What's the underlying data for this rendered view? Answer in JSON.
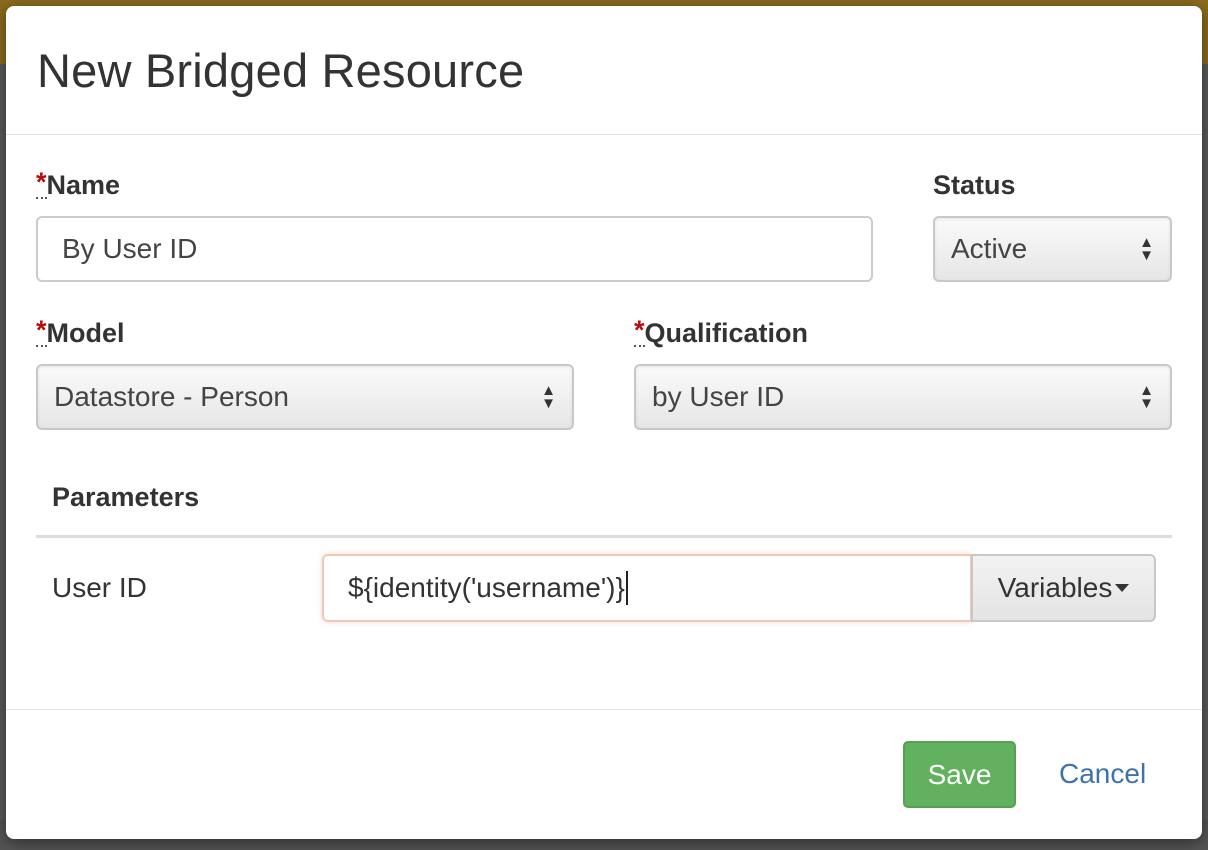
{
  "modal": {
    "title": "New Bridged Resource"
  },
  "form": {
    "required_marker": "*",
    "name": {
      "label": "Name",
      "value": "By User ID"
    },
    "status": {
      "label": "Status",
      "value": "Active"
    },
    "model": {
      "label": "Model",
      "value": "Datastore - Person"
    },
    "qualification": {
      "label": "Qualification",
      "value": "by User ID"
    }
  },
  "parameters": {
    "title": "Parameters",
    "rows": [
      {
        "label": "User ID",
        "value": "${identity('username')}"
      }
    ],
    "variables_button": "Variables"
  },
  "footer": {
    "save_label": "Save",
    "cancel_label": "Cancel"
  },
  "colors": {
    "required": "#b70d0d",
    "save": "#62b15e",
    "link": "#3f72ad"
  }
}
